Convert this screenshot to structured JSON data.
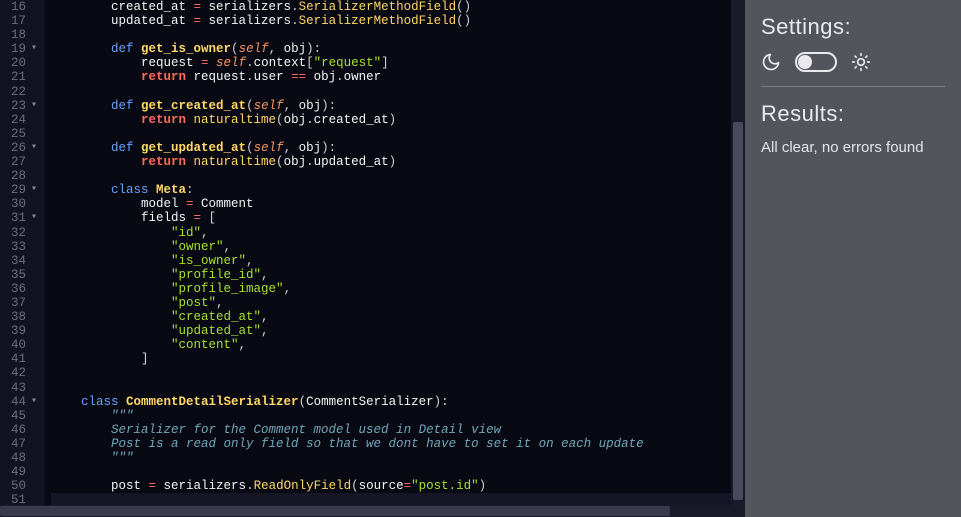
{
  "settings": {
    "heading": "Settings:",
    "theme_mode": "dark"
  },
  "results": {
    "heading": "Results:",
    "message": "All clear, no errors found"
  },
  "editor": {
    "first_line": 16,
    "lines": [
      {
        "n": 16,
        "fold": "",
        "tokens": [
          [
            "        ",
            "punct"
          ],
          [
            "created_at ",
            "name"
          ],
          [
            "= ",
            "op"
          ],
          [
            "serializers",
            "name"
          ],
          [
            ".",
            "punct"
          ],
          [
            "SerializerMethodField",
            "builtin"
          ],
          [
            "()",
            "punct"
          ]
        ]
      },
      {
        "n": 17,
        "fold": "",
        "tokens": [
          [
            "        ",
            "punct"
          ],
          [
            "updated_at ",
            "name"
          ],
          [
            "= ",
            "op"
          ],
          [
            "serializers",
            "name"
          ],
          [
            ".",
            "punct"
          ],
          [
            "SerializerMethodField",
            "builtin"
          ],
          [
            "()",
            "punct"
          ]
        ]
      },
      {
        "n": 18,
        "fold": "",
        "tokens": [
          [
            "",
            "punct"
          ]
        ]
      },
      {
        "n": 19,
        "fold": "▾",
        "tokens": [
          [
            "        ",
            "punct"
          ],
          [
            "def ",
            "kw-def"
          ],
          [
            "get_is_owner",
            "fn-name"
          ],
          [
            "(",
            "punct"
          ],
          [
            "self",
            "self"
          ],
          [
            ", ",
            "punct"
          ],
          [
            "obj",
            "name"
          ],
          [
            "):",
            "punct"
          ]
        ]
      },
      {
        "n": 20,
        "fold": "",
        "tokens": [
          [
            "            ",
            "punct"
          ],
          [
            "request ",
            "name"
          ],
          [
            "= ",
            "op"
          ],
          [
            "self",
            "self"
          ],
          [
            ".",
            "punct"
          ],
          [
            "context",
            "name"
          ],
          [
            "[",
            "punct"
          ],
          [
            "\"request\"",
            "string"
          ],
          [
            "]",
            "punct"
          ]
        ]
      },
      {
        "n": 21,
        "fold": "",
        "tokens": [
          [
            "            ",
            "punct"
          ],
          [
            "return ",
            "kw-ret"
          ],
          [
            "request",
            "name"
          ],
          [
            ".",
            "punct"
          ],
          [
            "user ",
            "name"
          ],
          [
            "== ",
            "op"
          ],
          [
            "obj",
            "name"
          ],
          [
            ".",
            "punct"
          ],
          [
            "owner",
            "name"
          ]
        ]
      },
      {
        "n": 22,
        "fold": "",
        "tokens": [
          [
            "",
            "punct"
          ]
        ]
      },
      {
        "n": 23,
        "fold": "▾",
        "tokens": [
          [
            "        ",
            "punct"
          ],
          [
            "def ",
            "kw-def"
          ],
          [
            "get_created_at",
            "fn-name"
          ],
          [
            "(",
            "punct"
          ],
          [
            "self",
            "self"
          ],
          [
            ", ",
            "punct"
          ],
          [
            "obj",
            "name"
          ],
          [
            "):",
            "punct"
          ]
        ]
      },
      {
        "n": 24,
        "fold": "",
        "tokens": [
          [
            "            ",
            "punct"
          ],
          [
            "return ",
            "kw-ret"
          ],
          [
            "naturaltime",
            "builtin"
          ],
          [
            "(",
            "punct"
          ],
          [
            "obj",
            "name"
          ],
          [
            ".",
            "punct"
          ],
          [
            "created_at",
            "name"
          ],
          [
            ")",
            "punct"
          ]
        ]
      },
      {
        "n": 25,
        "fold": "",
        "tokens": [
          [
            "",
            "punct"
          ]
        ]
      },
      {
        "n": 26,
        "fold": "▾",
        "tokens": [
          [
            "        ",
            "punct"
          ],
          [
            "def ",
            "kw-def"
          ],
          [
            "get_updated_at",
            "fn-name"
          ],
          [
            "(",
            "punct"
          ],
          [
            "self",
            "self"
          ],
          [
            ", ",
            "punct"
          ],
          [
            "obj",
            "name"
          ],
          [
            "):",
            "punct"
          ]
        ]
      },
      {
        "n": 27,
        "fold": "",
        "tokens": [
          [
            "            ",
            "punct"
          ],
          [
            "return ",
            "kw-ret"
          ],
          [
            "naturaltime",
            "builtin"
          ],
          [
            "(",
            "punct"
          ],
          [
            "obj",
            "name"
          ],
          [
            ".",
            "punct"
          ],
          [
            "updated_at",
            "name"
          ],
          [
            ")",
            "punct"
          ]
        ]
      },
      {
        "n": 28,
        "fold": "",
        "tokens": [
          [
            "",
            "punct"
          ]
        ]
      },
      {
        "n": 29,
        "fold": "▾",
        "tokens": [
          [
            "        ",
            "punct"
          ],
          [
            "class ",
            "kw-class"
          ],
          [
            "Meta",
            "fn-name"
          ],
          [
            ":",
            "punct"
          ]
        ]
      },
      {
        "n": 30,
        "fold": "",
        "tokens": [
          [
            "            ",
            "punct"
          ],
          [
            "model ",
            "name"
          ],
          [
            "= ",
            "op"
          ],
          [
            "Comment",
            "name"
          ]
        ]
      },
      {
        "n": 31,
        "fold": "▾",
        "tokens": [
          [
            "            ",
            "punct"
          ],
          [
            "fields ",
            "name"
          ],
          [
            "= ",
            "op"
          ],
          [
            "[",
            "punct"
          ]
        ]
      },
      {
        "n": 32,
        "fold": "",
        "tokens": [
          [
            "                ",
            "punct"
          ],
          [
            "\"id\"",
            "string"
          ],
          [
            ",",
            "punct"
          ]
        ]
      },
      {
        "n": 33,
        "fold": "",
        "tokens": [
          [
            "                ",
            "punct"
          ],
          [
            "\"owner\"",
            "string"
          ],
          [
            ",",
            "punct"
          ]
        ]
      },
      {
        "n": 34,
        "fold": "",
        "tokens": [
          [
            "                ",
            "punct"
          ],
          [
            "\"is_owner\"",
            "string"
          ],
          [
            ",",
            "punct"
          ]
        ]
      },
      {
        "n": 35,
        "fold": "",
        "tokens": [
          [
            "                ",
            "punct"
          ],
          [
            "\"profile_id\"",
            "string"
          ],
          [
            ",",
            "punct"
          ]
        ]
      },
      {
        "n": 36,
        "fold": "",
        "tokens": [
          [
            "                ",
            "punct"
          ],
          [
            "\"profile_image\"",
            "string"
          ],
          [
            ",",
            "punct"
          ]
        ]
      },
      {
        "n": 37,
        "fold": "",
        "tokens": [
          [
            "                ",
            "punct"
          ],
          [
            "\"post\"",
            "string"
          ],
          [
            ",",
            "punct"
          ]
        ]
      },
      {
        "n": 38,
        "fold": "",
        "tokens": [
          [
            "                ",
            "punct"
          ],
          [
            "\"created_at\"",
            "string"
          ],
          [
            ",",
            "punct"
          ]
        ]
      },
      {
        "n": 39,
        "fold": "",
        "tokens": [
          [
            "                ",
            "punct"
          ],
          [
            "\"updated_at\"",
            "string"
          ],
          [
            ",",
            "punct"
          ]
        ]
      },
      {
        "n": 40,
        "fold": "",
        "tokens": [
          [
            "                ",
            "punct"
          ],
          [
            "\"content\"",
            "string"
          ],
          [
            ",",
            "punct"
          ]
        ]
      },
      {
        "n": 41,
        "fold": "",
        "tokens": [
          [
            "            ",
            "punct"
          ],
          [
            "]",
            "punct"
          ]
        ]
      },
      {
        "n": 42,
        "fold": "",
        "tokens": [
          [
            "",
            "punct"
          ]
        ]
      },
      {
        "n": 43,
        "fold": "",
        "tokens": [
          [
            "",
            "punct"
          ]
        ]
      },
      {
        "n": 44,
        "fold": "▾",
        "tokens": [
          [
            "    ",
            "punct"
          ],
          [
            "class ",
            "kw-class"
          ],
          [
            "CommentDetailSerializer",
            "fn-name"
          ],
          [
            "(",
            "punct"
          ],
          [
            "CommentSerializer",
            "name"
          ],
          [
            "):",
            "punct"
          ]
        ]
      },
      {
        "n": 45,
        "fold": "",
        "tokens": [
          [
            "        ",
            "punct"
          ],
          [
            "\"\"\"",
            "docstr"
          ]
        ]
      },
      {
        "n": 46,
        "fold": "",
        "tokens": [
          [
            "        ",
            "punct"
          ],
          [
            "Serializer for the Comment model used in Detail view",
            "docstr"
          ]
        ]
      },
      {
        "n": 47,
        "fold": "",
        "tokens": [
          [
            "        ",
            "punct"
          ],
          [
            "Post is a read only field so that we dont have to set it on each update",
            "docstr"
          ]
        ]
      },
      {
        "n": 48,
        "fold": "",
        "tokens": [
          [
            "        ",
            "punct"
          ],
          [
            "\"\"\"",
            "docstr"
          ]
        ]
      },
      {
        "n": 49,
        "fold": "",
        "tokens": [
          [
            "",
            "punct"
          ]
        ]
      },
      {
        "n": 50,
        "fold": "",
        "tokens": [
          [
            "        ",
            "punct"
          ],
          [
            "post ",
            "name"
          ],
          [
            "= ",
            "op"
          ],
          [
            "serializers",
            "name"
          ],
          [
            ".",
            "punct"
          ],
          [
            "ReadOnlyField",
            "builtin"
          ],
          [
            "(",
            "punct"
          ],
          [
            "source",
            "name"
          ],
          [
            "=",
            "op"
          ],
          [
            "\"post.id\"",
            "string"
          ],
          [
            ")",
            "punct"
          ]
        ]
      },
      {
        "n": 51,
        "fold": "",
        "cursor": true,
        "tokens": [
          [
            "    ",
            "punct"
          ]
        ]
      }
    ]
  }
}
